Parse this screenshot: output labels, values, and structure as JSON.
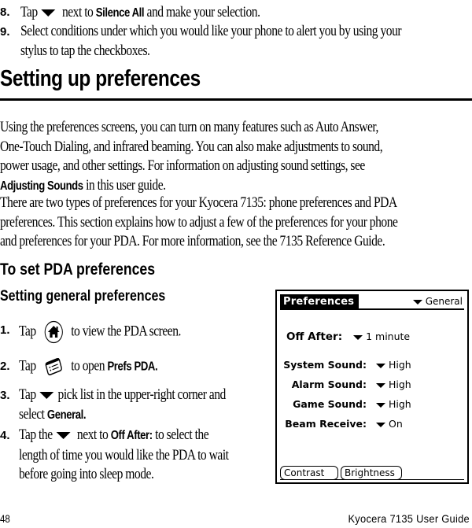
{
  "steps_top": [
    {
      "num": "8.",
      "pre": "Tap",
      "icon": "dropdown-triangle",
      "post_a": "next to",
      "bold": "Silence All",
      "post_b": "and make your selection."
    },
    {
      "num": "9.",
      "line1": "Select conditions under which you would like your phone to alert you by using your",
      "line2": "stylus to tap the checkboxes."
    }
  ],
  "section": {
    "title": "Setting up preferences",
    "para1": {
      "lines": [
        "Using the preferences screens, you can turn on many features such as Auto Answer,",
        "One-Touch Dialing, and infrared beaming. You can also make adjustments to sound,",
        "power usage, and other settings. For information on adjusting sound settings, see"
      ],
      "bold": "Adjusting Sounds",
      "tail": "in this user guide."
    },
    "para2": {
      "lines": [
        "There are two types of preferences for your Kyocera 7135: phone preferences and PDA",
        "preferences. This section explains how to adjust a few of the preferences for your phone",
        "and preferences for your PDA. For more information, see the 7135 Reference Guide."
      ]
    }
  },
  "subsection": {
    "title": "To set PDA preferences",
    "subtitle": "Setting general preferences"
  },
  "steps": [
    {
      "num": "1.",
      "pre": "Tap",
      "icon": "home-icon",
      "post": "to view the PDA screen."
    },
    {
      "num": "2.",
      "pre": "Tap",
      "icon": "prefs-icon",
      "post": "to open",
      "bold": "Prefs PDA."
    },
    {
      "num": "3.",
      "pre": "Tap",
      "icon": "dropdown-triangle",
      "post": "pick list in the upper-right corner and",
      "line2_pre": "select",
      "line2_bold": "General."
    },
    {
      "num": "4.",
      "pre": "Tap the",
      "icon": "dropdown-triangle",
      "post": "next to",
      "bold": "Off After:",
      "post2": "to select the",
      "line2": "length of time you would like the PDA to wait",
      "line3": "before going into sleep mode."
    }
  ],
  "pda_screen": {
    "title": "Preferences",
    "category": "General",
    "off_after": {
      "label": "Off After:",
      "value": "1 minute"
    },
    "settings": [
      {
        "label": "System Sound:",
        "value": "High"
      },
      {
        "label": "Alarm Sound:",
        "value": "High"
      },
      {
        "label": "Game Sound:",
        "value": "High"
      },
      {
        "label": "Beam Receive:",
        "value": "On"
      }
    ],
    "buttons": [
      "Contrast",
      "Brightness"
    ]
  },
  "footer": {
    "page_number": "48",
    "guide_title": "Kyocera 7135 User Guide"
  }
}
